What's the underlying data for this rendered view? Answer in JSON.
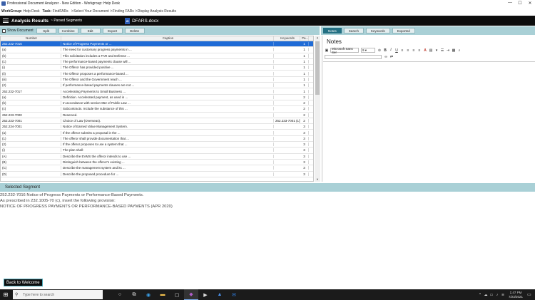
{
  "window": {
    "title": "Professional Document Analyzer - New Edition - Workgroup: Help Desk",
    "controls": [
      "—",
      "☐",
      "✕"
    ]
  },
  "taskline": {
    "workgroup_label": "WorkGroup:",
    "workgroup_value": "Help Desk",
    "task_label": "Task:",
    "task_value": "FindFARs",
    "steps": "ᐳSelect Your Document  ᐳFinding FARs  ᐳDisplay Analysis Results"
  },
  "ribbon": {
    "title": "Analysis Results",
    "subtitle": "~ Parsed Segments",
    "doc_icon": "W",
    "doc_name": "DFARS.docx"
  },
  "toolbar": {
    "show_document": "Show Document",
    "buttons": [
      "Split",
      "Combine",
      "Edit",
      "Export",
      "Delete"
    ]
  },
  "grid": {
    "columns": [
      "Number",
      "Caption",
      "Keywords",
      "Pa..."
    ],
    "rows": [
      {
        "number": "252.232-7016",
        "caption": "Notice of Progress Payments or ...",
        "keywords": "",
        "page": "1",
        "selected": true
      },
      {
        "number": "(a)",
        "caption": "The need for customary progress payments in ...",
        "keywords": "",
        "page": "1"
      },
      {
        "number": "(b)",
        "caption": "This solicitation includes a FAR and Defense ...",
        "keywords": "",
        "page": "1"
      },
      {
        "number": "(1)",
        "caption": "The performance-based payments clause will ...",
        "keywords": "",
        "page": "1"
      },
      {
        "number": "(i)",
        "caption": "The Offeror has provided positive ...",
        "keywords": "",
        "page": "1"
      },
      {
        "number": "(ii)",
        "caption": "The Offeror proposes a performance-based ...",
        "keywords": "",
        "page": "1"
      },
      {
        "number": "(iii)",
        "caption": "The Offeror and the Government reach ...",
        "keywords": "",
        "page": "1"
      },
      {
        "number": "(2)",
        "caption": "If performance-based payments clauses are not ...",
        "keywords": "",
        "page": "1"
      },
      {
        "number": "252.232-7017",
        "caption": "Accelerating Payments to Small Business ...",
        "keywords": "",
        "page": "1"
      },
      {
        "number": "(a)",
        "caption": "Definition.  Accelerated payment,  as used in ...",
        "keywords": "",
        "page": "2"
      },
      {
        "number": "(b)",
        "caption": "In accordance with section 852 of Public Law ...",
        "keywords": "",
        "page": "2"
      },
      {
        "number": "(c)",
        "caption": "Subcontracts. Include the substance of this ...",
        "keywords": "",
        "page": "2"
      },
      {
        "number": "252.233-7000",
        "caption": "Reserved.",
        "keywords": "",
        "page": "2"
      },
      {
        "number": "252.233-7001",
        "caption": "Choice of Law (Overseas).",
        "keywords": "252.233-7001 (1)",
        "page": "2"
      },
      {
        "number": "252.234-7001",
        "caption": "Notice of Earned Value Management System.",
        "keywords": "",
        "page": "3"
      },
      {
        "number": "(a)",
        "caption": "If the offeror submits a proposal in the ...",
        "keywords": "",
        "page": "3"
      },
      {
        "number": "(1)",
        "caption": "The offeror shall provide documentation that ...",
        "keywords": "",
        "page": "3"
      },
      {
        "number": "(2)",
        "caption": "If the offeror proposes to use a system that ...",
        "keywords": "",
        "page": "3"
      },
      {
        "number": "(i)",
        "caption": "The plan shall-",
        "keywords": "",
        "page": "3"
      },
      {
        "number": "(A)",
        "caption": "Describe the EVMS the offeror intends to use ...",
        "keywords": "",
        "page": "3"
      },
      {
        "number": "(B)",
        "caption": "Distinguish between the offeror's existing ...",
        "keywords": "",
        "page": "3"
      },
      {
        "number": "(C)",
        "caption": "Describe the management system and its ...",
        "keywords": "",
        "page": "3"
      },
      {
        "number": "(D)",
        "caption": "Describe the proposed procedure for ...",
        "keywords": "",
        "page": "3"
      }
    ]
  },
  "panel_tabs": [
    "Notes",
    "Search",
    "Keywords",
    "Exported"
  ],
  "notes": {
    "title": "Notes",
    "font": "Microsoft Sans Ser",
    "size": "9"
  },
  "selected_segment": {
    "header": "Selected Segment",
    "lines": [
      "252.232-7016 Notice of Progress Payments or Performance-Based Payments.",
      "As prescribed in 232.1005-70 (c), insert the following provision:",
      "NOTICE OF PROGRESS PAYMENTS OR PERFORMANCE-BASED PAYMENTS (APR 2020)"
    ]
  },
  "back_button": "Back to Welcome",
  "taskbar": {
    "search_placeholder": "Type here to search",
    "time": "1:47 PM",
    "date": "7/23/2021"
  }
}
